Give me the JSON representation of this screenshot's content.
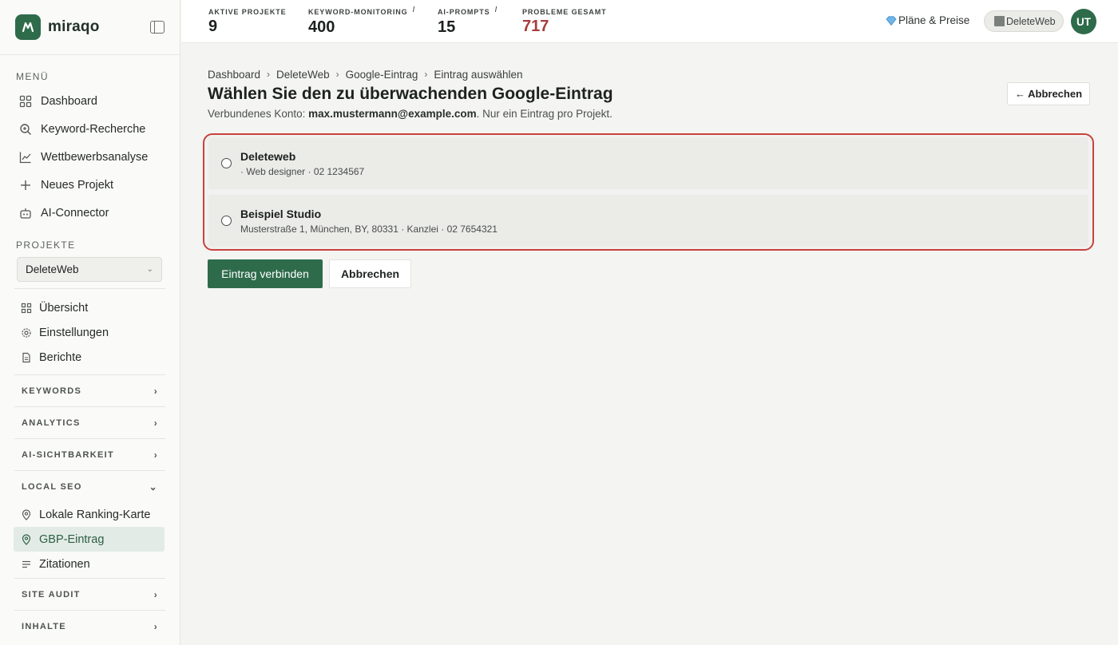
{
  "brand": {
    "name": "miraqo",
    "accent": "#2e6b4b"
  },
  "sidebar": {
    "menu_title": "MENÜ",
    "menu_items": [
      {
        "label": "Dashboard",
        "icon": "grid-icon"
      },
      {
        "label": "Keyword-Recherche",
        "icon": "search-icon"
      },
      {
        "label": "Wettbewerbsanalyse",
        "icon": "chart-line-icon"
      },
      {
        "label": "Neues Projekt",
        "icon": "plus-icon"
      },
      {
        "label": "AI-Connector",
        "icon": "robot-icon"
      }
    ],
    "projects_title": "PROJEKTE",
    "project_select": "DeleteWeb",
    "project_items": [
      {
        "label": "Übersicht",
        "icon": "grid-icon"
      },
      {
        "label": "Einstellungen",
        "icon": "gear-icon"
      },
      {
        "label": "Berichte",
        "icon": "document-icon"
      }
    ],
    "groups": {
      "keywords": "KEYWORDS",
      "analytics": "ANALYTICS",
      "ai_visibility": "AI-SICHTBARKEIT",
      "local_seo": "LOCAL SEO",
      "site_audit": "SITE AUDIT",
      "content": "INHALTE"
    },
    "local_seo_items": [
      {
        "label": "Lokale Ranking-Karte",
        "icon": "map-pin-icon",
        "active": false
      },
      {
        "label": "GBP-Eintrag",
        "icon": "map-pin-icon",
        "active": true
      },
      {
        "label": "Zitationen",
        "icon": "list-icon",
        "active": false
      }
    ]
  },
  "topbar": {
    "stats": [
      {
        "label": "AKTIVE PROJEKTE",
        "value": "9",
        "info": ""
      },
      {
        "label": "KEYWORD-MONITORING",
        "value": "400",
        "info": "i"
      },
      {
        "label": "AI-PROMPTS",
        "value": "15",
        "info": "i"
      },
      {
        "label": "PROBLEME GESAMT",
        "value": "717",
        "info": ""
      }
    ],
    "plans_label": "Pläne & Preise",
    "project_pill": "DeleteWeb",
    "avatar_initials": "UT"
  },
  "main": {
    "breadcrumb": [
      "Dashboard",
      "DeleteWeb",
      "Google-Eintrag",
      "Eintrag auswählen"
    ],
    "title": "Wählen Sie den zu überwachenden Google-Eintrag",
    "subtitle_prefix": "Verbundenes Konto: ",
    "account_email": "max.mustermann@example.com",
    "subtitle_suffix": ". Nur ein Eintrag pro Projekt.",
    "cancel_top": "← Abbrechen",
    "entries": [
      {
        "name": "Deleteweb",
        "desc": "· Web designer · 02 1234567"
      },
      {
        "name": "Beispiel Studio",
        "desc": "Musterstraße 1, München, BY, 80331 · Kanzlei · 02 7654321"
      }
    ],
    "connect_button": "Eintrag verbinden",
    "cancel_button": "Abbrechen"
  }
}
